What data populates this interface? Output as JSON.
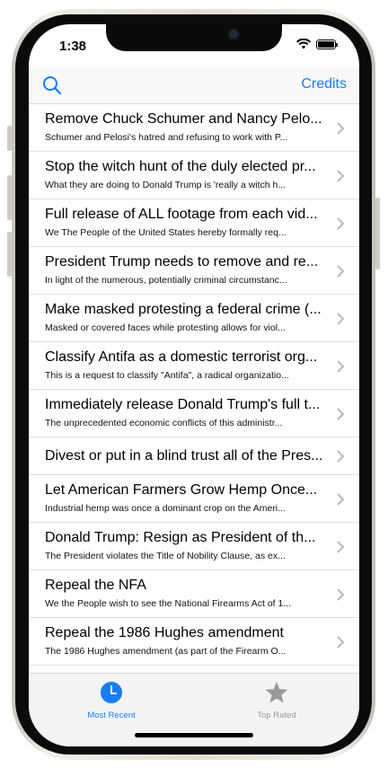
{
  "status_bar": {
    "time": "1:38"
  },
  "navbar": {
    "search_icon": "search-icon",
    "credits_label": "Credits"
  },
  "petitions": [
    {
      "title": "Remove Chuck Schumer and Nancy Pelo...",
      "subtitle": "Schumer and Pelosi's hatred and refusing to work with P..."
    },
    {
      "title": "Stop the witch hunt of the duly elected pr...",
      "subtitle": "What they are doing to Donald Trump is 'really a witch h..."
    },
    {
      "title": "Full release of ALL footage from each vid...",
      "subtitle": "We The People of the United States hereby formally req..."
    },
    {
      "title": "President Trump needs to remove and re...",
      "subtitle": "In light of the numerous, potentially criminal circumstanc..."
    },
    {
      "title": "Make masked protesting a federal crime (...",
      "subtitle": "Masked or covered faces while protesting allows for viol..."
    },
    {
      "title": "Classify Antifa as a domestic terrorist org...",
      "subtitle": "This is a request to classify \"Antifa\", a radical organizatio..."
    },
    {
      "title": "Immediately release Donald Trump's full t...",
      "subtitle": "The unprecedented economic conflicts of this administr..."
    },
    {
      "title": "Divest or put in a blind trust all of the Pres...",
      "subtitle": ""
    },
    {
      "title": "Let American Farmers Grow Hemp Once...",
      "subtitle": "Industrial hemp was once a dominant crop on the Ameri..."
    },
    {
      "title": "Donald Trump:  Resign as President of th...",
      "subtitle": "The President violates the Title of Nobility Clause, as ex..."
    },
    {
      "title": "Repeal the NFA",
      "subtitle": "We the People wish to see the National Firearms Act of 1..."
    },
    {
      "title": "Repeal the 1986 Hughes amendment",
      "subtitle": "The 1986 Hughes amendment (as part of the Firearm O..."
    }
  ],
  "tabs": [
    {
      "label": "Most Recent",
      "icon": "clock-icon",
      "selected": true
    },
    {
      "label": "Top Rated",
      "icon": "star-icon",
      "selected": false
    }
  ],
  "colors": {
    "accent": "#1a7cf5",
    "inactive": "#9a9a9a"
  }
}
